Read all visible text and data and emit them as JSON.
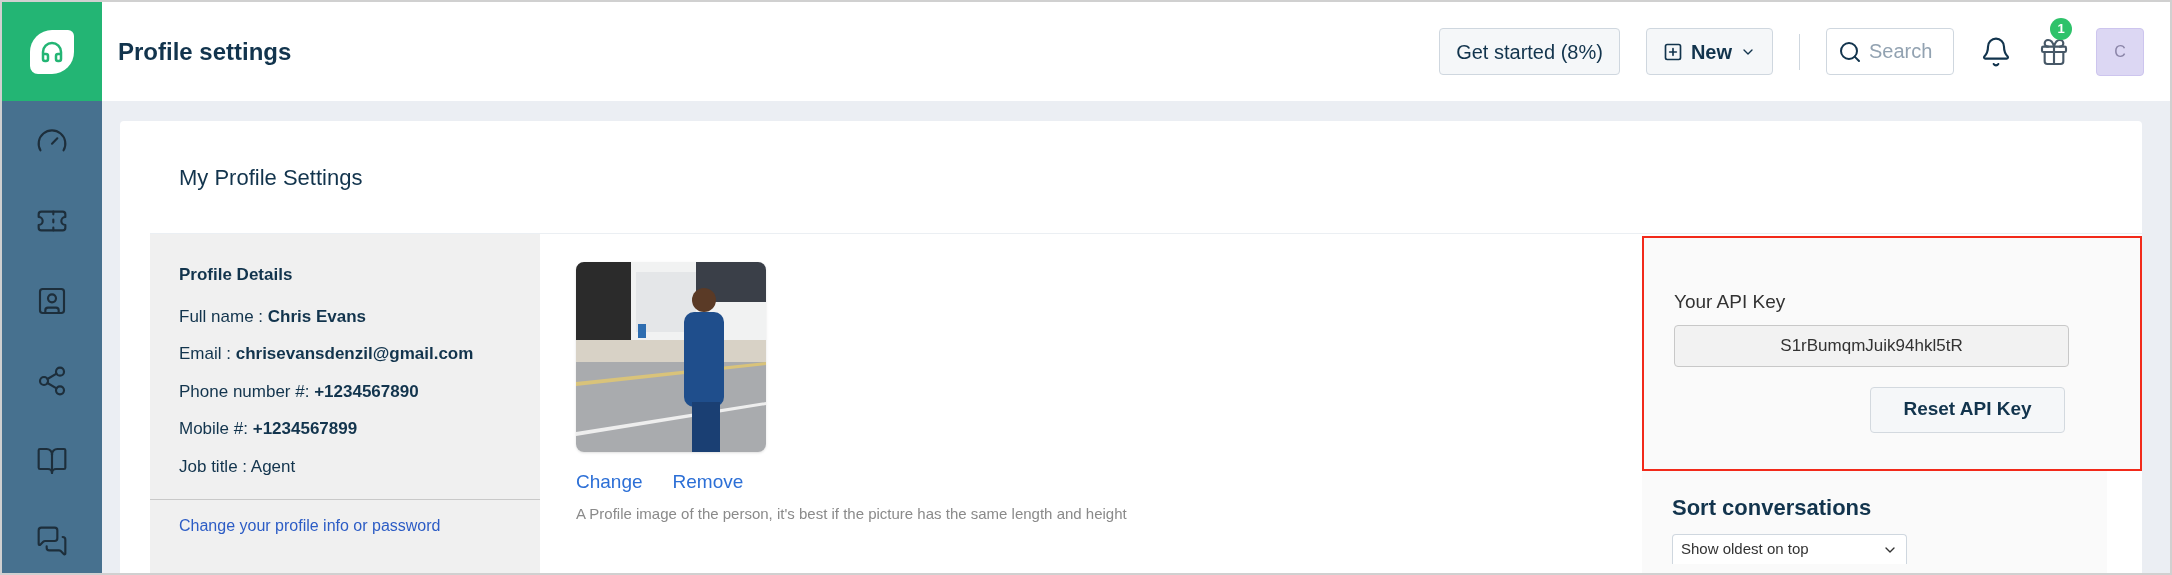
{
  "header": {
    "title": "Profile settings",
    "get_started": "Get started (8%)",
    "new_button": "New",
    "search": {
      "placeholder": "Search"
    },
    "gift_badge": "1",
    "avatar": "C"
  },
  "page": {
    "title": "My Profile Settings"
  },
  "profile_details": {
    "heading": "Profile Details",
    "lines": [
      "Full name : **Chris Evans**",
      "Email : **chrisevansdenzil@gmail.com**",
      "Phone number #: **+1234567890**",
      "Mobile #: **+1234567899**",
      "Job title : Agent"
    ],
    "link": "Change your profile info or password"
  },
  "photo": {
    "kind": "picture",
    "actions": [
      "Change",
      "Remove"
    ],
    "caption": "A Profile image of the person, it's best if the picture has the same length and height"
  },
  "api_key": {
    "label": "Your API Key",
    "value": "S1rBumqmJuik94hkl5tR",
    "button": "Reset API Key",
    "highlighted": true
  },
  "sort": {
    "heading": "Sort conversations",
    "value": "Show oldest on top"
  }
}
